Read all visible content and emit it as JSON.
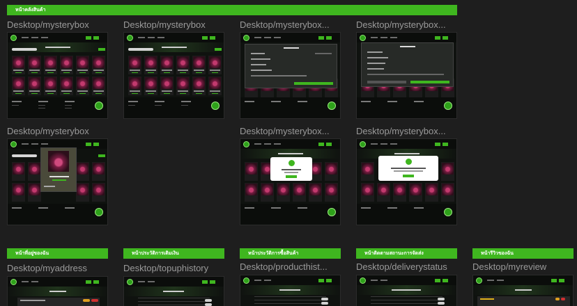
{
  "sections": {
    "top": "หน้าคลังสินค้า",
    "myaddress": "หน้าที่อยู่ของฉัน",
    "topup": "หน้าประวัติการเติมเงิน",
    "product": "หน้าประวัติการซื้อสินค้า",
    "delivery": "หน้าติดตามสถานะการจัดส่ง",
    "review": "หน้ารีวิวของฉัน"
  },
  "frames": {
    "f1": "Desktop/mysterybox",
    "f2": "Desktop/mysterybox",
    "f3": "Desktop/mysterybox...",
    "f4": "Desktop/mysterybox...",
    "f5": "Desktop/mysterybox",
    "f6": "Desktop/mysterybox...",
    "f7": "Desktop/mysterybox...",
    "f8": "Desktop/myaddress",
    "f9": "Desktop/topuphistory",
    "f10": "Desktop/producthist...",
    "f11": "Desktop/deliverystatus",
    "f12": "Desktop/myreview"
  },
  "colors": {
    "accent": "#3fb61f",
    "canvas": "#1e1e1e",
    "frame_bg": "#0f120f"
  },
  "icons": {
    "logo": "xbox-logo-icon",
    "check": "check-circle-icon"
  }
}
